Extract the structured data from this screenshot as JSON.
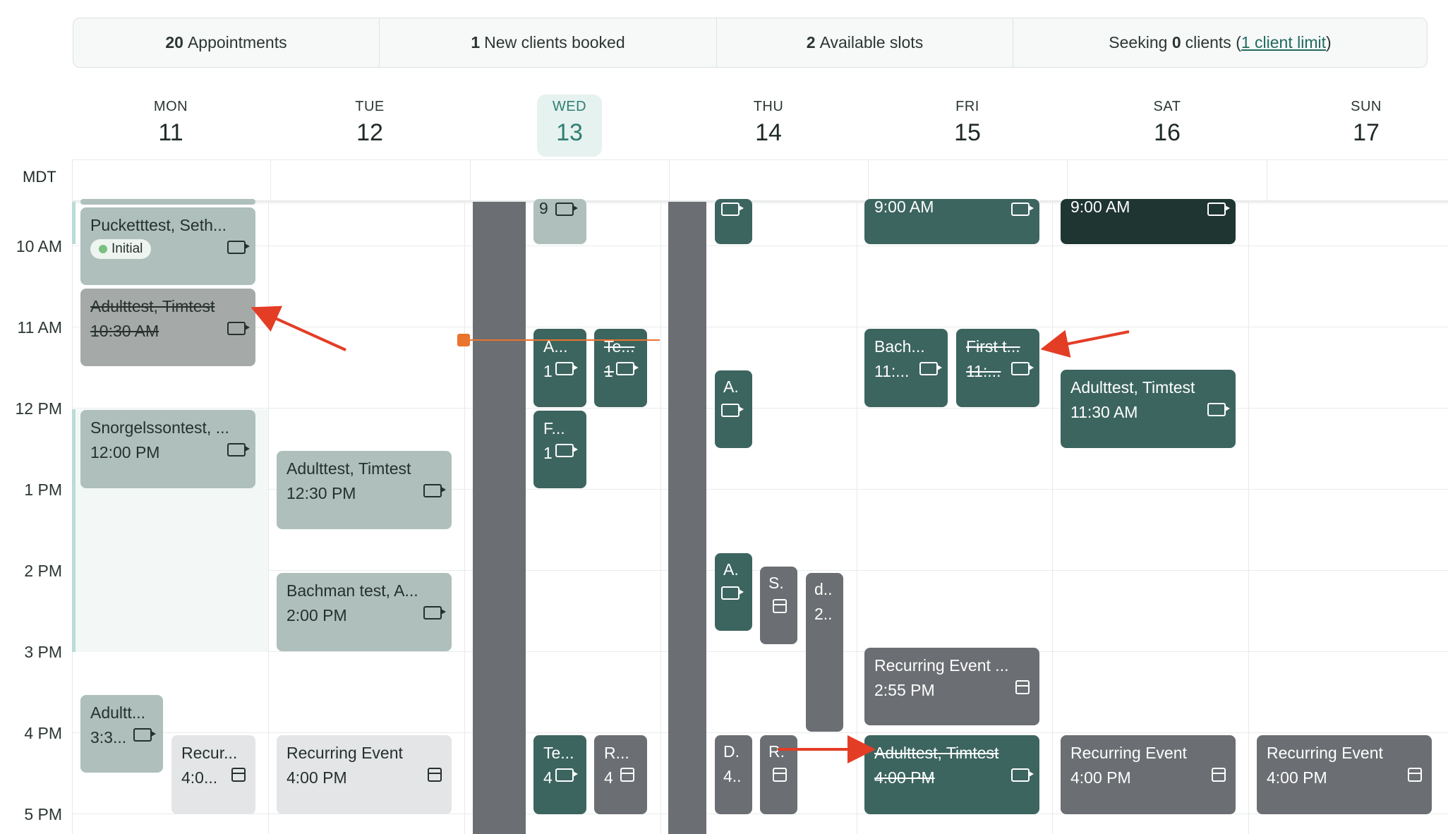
{
  "stats": {
    "appointments": {
      "count": "20",
      "label": "Appointments"
    },
    "new_clients": {
      "count": "1",
      "label": "New clients booked"
    },
    "available": {
      "count": "2",
      "label": "Available slots"
    },
    "seeking": {
      "prefix": "Seeking",
      "count": "0",
      "suffix": "clients (",
      "link": "1 client limit",
      "close": ")"
    }
  },
  "timezone": "MDT",
  "days": [
    {
      "dow": "MON",
      "num": "11"
    },
    {
      "dow": "TUE",
      "num": "12"
    },
    {
      "dow": "WED",
      "num": "13"
    },
    {
      "dow": "THU",
      "num": "14"
    },
    {
      "dow": "FRI",
      "num": "15"
    },
    {
      "dow": "SAT",
      "num": "16"
    },
    {
      "dow": "SUN",
      "num": "17"
    }
  ],
  "hours": [
    "10 AM",
    "11 AM",
    "12 PM",
    "1 PM",
    "2 PM",
    "3 PM",
    "4 PM",
    "5 PM"
  ],
  "events": {
    "mon_puckett": {
      "name": "Pucketttest, Seth...",
      "badge": "Initial"
    },
    "mon_adult_1030": {
      "name": "Adulttest, Timtest",
      "time": "10:30 AM"
    },
    "mon_snorgels": {
      "name": "Snorgelssontest, ...",
      "time": "12:00 PM"
    },
    "mon_adult_330": {
      "name": "Adultt...",
      "time": "3:3..."
    },
    "mon_recur": {
      "name": "Recur...",
      "time": "4:0..."
    },
    "tue_adult": {
      "name": "Adulttest, Timtest",
      "time": "12:30 PM"
    },
    "tue_bachman": {
      "name": "Bachman test, A...",
      "time": "2:00 PM"
    },
    "tue_recur": {
      "name": "Recurring Event",
      "time": "4:00 PM"
    },
    "wed_9": {
      "time": "9"
    },
    "wed_a": {
      "name": "A...",
      "time": "1."
    },
    "wed_te": {
      "name": "Te...",
      "time": "1."
    },
    "wed_f": {
      "name": "F...",
      "time": "1."
    },
    "wed_te4": {
      "name": "Te...",
      "time": "4"
    },
    "wed_r4": {
      "name": "R...",
      "time": "4"
    },
    "thu_a1": {
      "name": "A."
    },
    "thu_a2": {
      "name": "A."
    },
    "thu_s": {
      "name": "S."
    },
    "thu_d": {
      "name": "d..",
      "time": "2.."
    },
    "thu_d4": {
      "name": "D.",
      "time": "4.."
    },
    "thu_r4": {
      "name": "R."
    },
    "fri_9": {
      "time": "9:00 AM"
    },
    "fri_bach": {
      "name": "Bach...",
      "time": "11:..."
    },
    "fri_first": {
      "name": "First t...",
      "time": "11:..."
    },
    "fri_recur": {
      "name": "Recurring Event ...",
      "time": "2:55 PM"
    },
    "fri_adult4": {
      "name": "Adulttest, Timtest",
      "time": "4:00 PM"
    },
    "sat_9": {
      "time": "9:00 AM"
    },
    "sat_adult": {
      "name": "Adulttest, Timtest",
      "time": "11:30 AM"
    },
    "sat_recur": {
      "name": "Recurring Event",
      "time": "4:00 PM"
    },
    "sun_recur": {
      "name": "Recurring Event",
      "time": "4:00 PM"
    }
  },
  "colors": {
    "accent": "#2f7f72",
    "sage": "#aebfbc",
    "green": "#3c655f",
    "dark": "#1f3532",
    "slate": "#6b6e72",
    "now": "#e9742b",
    "arrow": "#e43d26"
  }
}
